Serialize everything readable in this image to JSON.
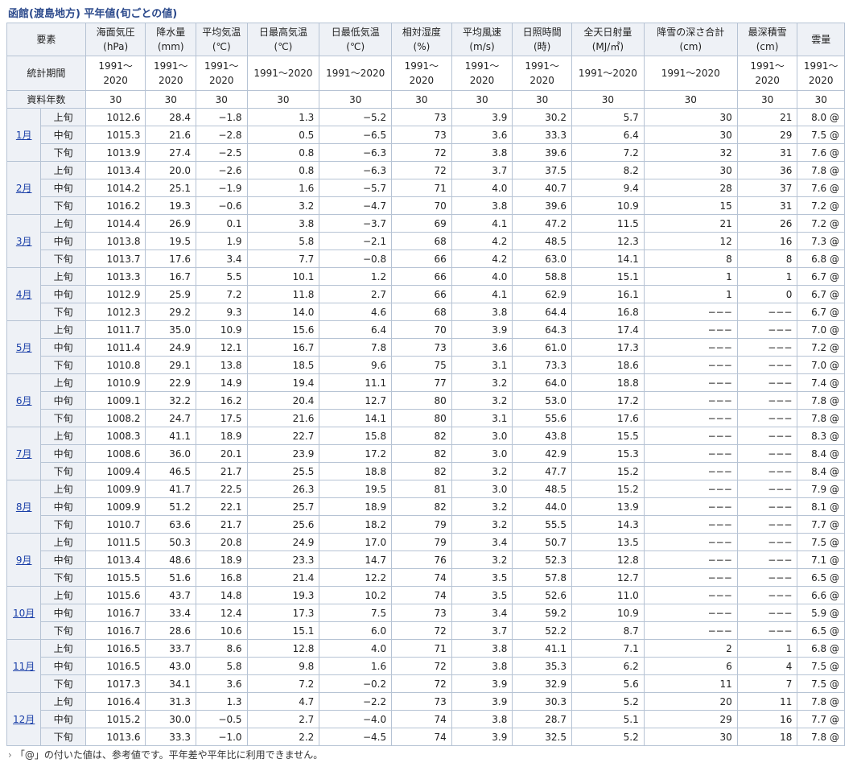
{
  "title": "函館(渡島地方) 平年値(旬ごとの値)",
  "headers": [
    "要素",
    "海面気圧\n(hPa)",
    "降水量\n(mm)",
    "平均気温\n(℃)",
    "日最高気温\n(℃)",
    "日最低気温\n(℃)",
    "相対湿度\n(%)",
    "平均風速\n(m/s)",
    "日照時間\n(時)",
    "全天日射量\n(MJ/㎡)",
    "降雪の深さ合計\n(cm)",
    "最深積雪\n(cm)",
    "雲量"
  ],
  "period_label": "統計期間",
  "period_value": "1991～2020",
  "years_label": "資料年数",
  "years_value": "30",
  "ten_day_labels": [
    "上旬",
    "中旬",
    "下旬"
  ],
  "months": [
    {
      "label": "1月",
      "rows": [
        [
          "1012.6",
          "28.4",
          "−1.8",
          "1.3",
          "−5.2",
          "73",
          "3.9",
          "30.2",
          "5.7",
          "30",
          "21",
          "8.0 @"
        ],
        [
          "1015.3",
          "21.6",
          "−2.8",
          "0.5",
          "−6.5",
          "73",
          "3.6",
          "33.3",
          "6.4",
          "30",
          "29",
          "7.5 @"
        ],
        [
          "1013.9",
          "27.4",
          "−2.5",
          "0.8",
          "−6.3",
          "72",
          "3.8",
          "39.6",
          "7.2",
          "32",
          "31",
          "7.6 @"
        ]
      ]
    },
    {
      "label": "2月",
      "rows": [
        [
          "1013.4",
          "20.0",
          "−2.6",
          "0.8",
          "−6.3",
          "72",
          "3.7",
          "37.5",
          "8.2",
          "30",
          "36",
          "7.8 @"
        ],
        [
          "1014.2",
          "25.1",
          "−1.9",
          "1.6",
          "−5.7",
          "71",
          "4.0",
          "40.7",
          "9.4",
          "28",
          "37",
          "7.6 @"
        ],
        [
          "1016.2",
          "19.3",
          "−0.6",
          "3.2",
          "−4.7",
          "70",
          "3.8",
          "39.6",
          "10.9",
          "15",
          "31",
          "7.2 @"
        ]
      ]
    },
    {
      "label": "3月",
      "rows": [
        [
          "1014.4",
          "26.9",
          "0.1",
          "3.8",
          "−3.7",
          "69",
          "4.1",
          "47.2",
          "11.5",
          "21",
          "26",
          "7.2 @"
        ],
        [
          "1013.8",
          "19.5",
          "1.9",
          "5.8",
          "−2.1",
          "68",
          "4.2",
          "48.5",
          "12.3",
          "12",
          "16",
          "7.3 @"
        ],
        [
          "1013.7",
          "17.6",
          "3.4",
          "7.7",
          "−0.8",
          "66",
          "4.2",
          "63.0",
          "14.1",
          "8",
          "8",
          "6.8 @"
        ]
      ]
    },
    {
      "label": "4月",
      "rows": [
        [
          "1013.3",
          "16.7",
          "5.5",
          "10.1",
          "1.2",
          "66",
          "4.0",
          "58.8",
          "15.1",
          "1",
          "1",
          "6.7 @"
        ],
        [
          "1012.9",
          "25.9",
          "7.2",
          "11.8",
          "2.7",
          "66",
          "4.1",
          "62.9",
          "16.1",
          "1",
          "0",
          "6.7 @"
        ],
        [
          "1012.3",
          "29.2",
          "9.3",
          "14.0",
          "4.6",
          "68",
          "3.8",
          "64.4",
          "16.8",
          "−−−",
          "−−−",
          "6.7 @"
        ]
      ]
    },
    {
      "label": "5月",
      "rows": [
        [
          "1011.7",
          "35.0",
          "10.9",
          "15.6",
          "6.4",
          "70",
          "3.9",
          "64.3",
          "17.4",
          "−−−",
          "−−−",
          "7.0 @"
        ],
        [
          "1011.4",
          "24.9",
          "12.1",
          "16.7",
          "7.8",
          "73",
          "3.6",
          "61.0",
          "17.3",
          "−−−",
          "−−−",
          "7.2 @"
        ],
        [
          "1010.8",
          "29.1",
          "13.8",
          "18.5",
          "9.6",
          "75",
          "3.1",
          "73.3",
          "18.6",
          "−−−",
          "−−−",
          "7.0 @"
        ]
      ]
    },
    {
      "label": "6月",
      "rows": [
        [
          "1010.9",
          "22.9",
          "14.9",
          "19.4",
          "11.1",
          "77",
          "3.2",
          "64.0",
          "18.8",
          "−−−",
          "−−−",
          "7.4 @"
        ],
        [
          "1009.1",
          "32.2",
          "16.2",
          "20.4",
          "12.7",
          "80",
          "3.2",
          "53.0",
          "17.2",
          "−−−",
          "−−−",
          "7.8 @"
        ],
        [
          "1008.2",
          "24.7",
          "17.5",
          "21.6",
          "14.1",
          "80",
          "3.1",
          "55.6",
          "17.6",
          "−−−",
          "−−−",
          "7.8 @"
        ]
      ]
    },
    {
      "label": "7月",
      "rows": [
        [
          "1008.3",
          "41.1",
          "18.9",
          "22.7",
          "15.8",
          "82",
          "3.0",
          "43.8",
          "15.5",
          "−−−",
          "−−−",
          "8.3 @"
        ],
        [
          "1008.6",
          "36.0",
          "20.1",
          "23.9",
          "17.2",
          "82",
          "3.0",
          "42.9",
          "15.3",
          "−−−",
          "−−−",
          "8.4 @"
        ],
        [
          "1009.4",
          "46.5",
          "21.7",
          "25.5",
          "18.8",
          "82",
          "3.2",
          "47.7",
          "15.2",
          "−−−",
          "−−−",
          "8.4 @"
        ]
      ]
    },
    {
      "label": "8月",
      "rows": [
        [
          "1009.9",
          "41.7",
          "22.5",
          "26.3",
          "19.5",
          "81",
          "3.0",
          "48.5",
          "15.2",
          "−−−",
          "−−−",
          "7.9 @"
        ],
        [
          "1009.9",
          "51.2",
          "22.1",
          "25.7",
          "18.9",
          "82",
          "3.2",
          "44.0",
          "13.9",
          "−−−",
          "−−−",
          "8.1 @"
        ],
        [
          "1010.7",
          "63.6",
          "21.7",
          "25.6",
          "18.2",
          "79",
          "3.2",
          "55.5",
          "14.3",
          "−−−",
          "−−−",
          "7.7 @"
        ]
      ]
    },
    {
      "label": "9月",
      "rows": [
        [
          "1011.5",
          "50.3",
          "20.8",
          "24.9",
          "17.0",
          "79",
          "3.4",
          "50.7",
          "13.5",
          "−−−",
          "−−−",
          "7.5 @"
        ],
        [
          "1013.4",
          "48.6",
          "18.9",
          "23.3",
          "14.7",
          "76",
          "3.2",
          "52.3",
          "12.8",
          "−−−",
          "−−−",
          "7.1 @"
        ],
        [
          "1015.5",
          "51.6",
          "16.8",
          "21.4",
          "12.2",
          "74",
          "3.5",
          "57.8",
          "12.7",
          "−−−",
          "−−−",
          "6.5 @"
        ]
      ]
    },
    {
      "label": "10月",
      "rows": [
        [
          "1015.6",
          "43.7",
          "14.8",
          "19.3",
          "10.2",
          "74",
          "3.5",
          "52.6",
          "11.0",
          "−−−",
          "−−−",
          "6.6 @"
        ],
        [
          "1016.7",
          "33.4",
          "12.4",
          "17.3",
          "7.5",
          "73",
          "3.4",
          "59.2",
          "10.9",
          "−−−",
          "−−−",
          "5.9 @"
        ],
        [
          "1016.7",
          "28.6",
          "10.6",
          "15.1",
          "6.0",
          "72",
          "3.7",
          "52.2",
          "8.7",
          "−−−",
          "−−−",
          "6.5 @"
        ]
      ]
    },
    {
      "label": "11月",
      "rows": [
        [
          "1016.5",
          "33.7",
          "8.6",
          "12.8",
          "4.0",
          "71",
          "3.8",
          "41.1",
          "7.1",
          "2",
          "1",
          "6.8 @"
        ],
        [
          "1016.5",
          "43.0",
          "5.8",
          "9.8",
          "1.6",
          "72",
          "3.8",
          "35.3",
          "6.2",
          "6",
          "4",
          "7.5 @"
        ],
        [
          "1017.3",
          "34.1",
          "3.6",
          "7.2",
          "−0.2",
          "72",
          "3.9",
          "32.9",
          "5.6",
          "11",
          "7",
          "7.5 @"
        ]
      ]
    },
    {
      "label": "12月",
      "rows": [
        [
          "1016.4",
          "31.3",
          "1.3",
          "4.7",
          "−2.2",
          "73",
          "3.9",
          "30.3",
          "5.2",
          "20",
          "11",
          "7.8 @"
        ],
        [
          "1015.2",
          "30.0",
          "−0.5",
          "2.7",
          "−4.0",
          "74",
          "3.8",
          "28.7",
          "5.1",
          "29",
          "16",
          "7.7 @"
        ],
        [
          "1013.6",
          "33.3",
          "−1.0",
          "2.2",
          "−4.5",
          "74",
          "3.9",
          "32.5",
          "5.2",
          "30",
          "18",
          "7.8 @"
        ]
      ]
    }
  ],
  "note": "「@」の付いた値は、参考値です。平年差や平年比に利用できません。",
  "colors": {
    "header_bg": "#eef1f6",
    "border": "#b6c3d4",
    "link": "#1a3fa8",
    "title": "#2c4a8c"
  }
}
